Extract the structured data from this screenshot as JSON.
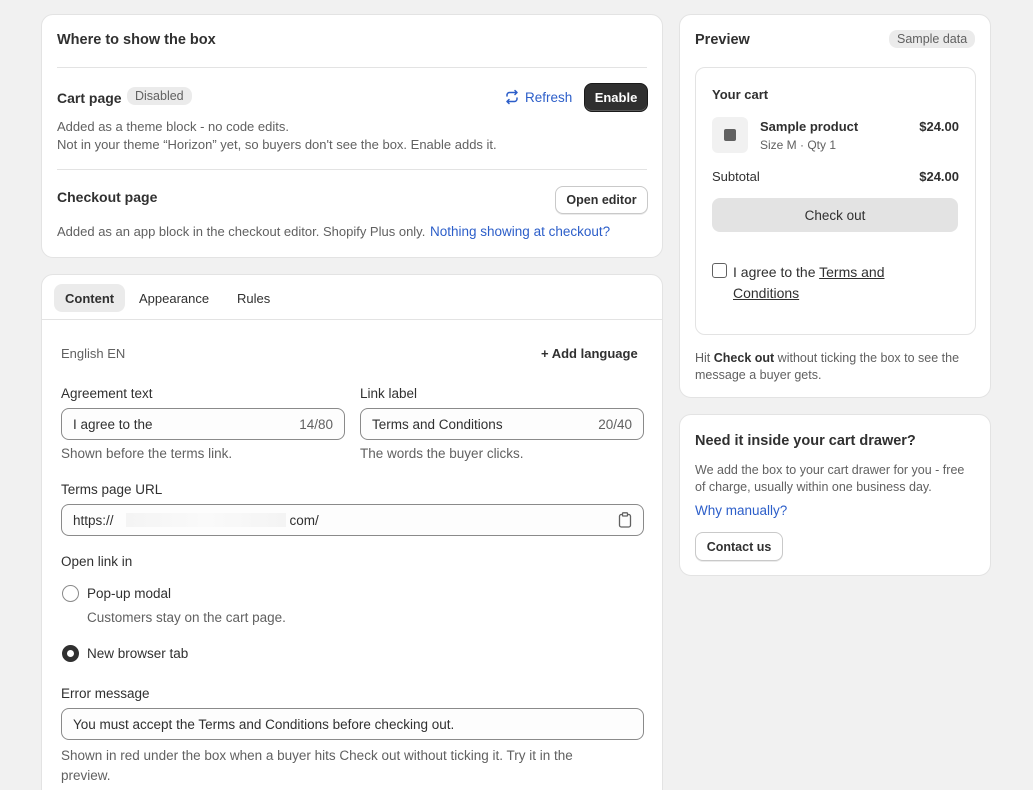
{
  "where": {
    "title": "Where to show the box",
    "cart": {
      "title": "Cart page",
      "badge": "Disabled",
      "refresh_label": "Refresh",
      "enable_label": "Enable",
      "desc1": "Added as a theme block - no code edits.",
      "desc2": "Not in your theme “Horizon” yet, so buyers don't see the box. Enable adds it."
    },
    "checkout": {
      "title": "Checkout page",
      "open_editor_label": "Open editor",
      "desc": "Added as an app block in the checkout editor. Shopify Plus only.",
      "link": "Nothing showing at checkout?"
    }
  },
  "editor": {
    "tabs": [
      {
        "label": "Content"
      },
      {
        "label": "Appearance"
      },
      {
        "label": "Rules"
      }
    ],
    "language": "English EN",
    "add_language_label": "+ Add language",
    "agreement": {
      "label": "Agreement text",
      "value": "I agree to the",
      "count": "14/80",
      "help": "Shown before the terms link."
    },
    "link_label": {
      "label": "Link label",
      "value": "Terms and Conditions",
      "count": "20/40",
      "help": "The words the buyer clicks."
    },
    "terms_url": {
      "label": "Terms page URL",
      "value_start": "https://",
      "value_end": "com/"
    },
    "open_link": {
      "label": "Open link in",
      "options": [
        {
          "label": "Pop-up modal",
          "help": "Customers stay on the cart page."
        },
        {
          "label": "New browser tab"
        }
      ],
      "selected": "New browser tab"
    },
    "error": {
      "label": "Error message",
      "value": "You must accept the Terms and Conditions before checking out.",
      "help": "Shown in red under the box when a buyer hits Check out without ticking it. Try it in the preview."
    }
  },
  "preview": {
    "title": "Preview",
    "badge": "Sample data",
    "cart_title": "Your cart",
    "product_name": "Sample product",
    "product_meta": "Size M · Qty 1",
    "product_price": "$24.00",
    "subtotal_label": "Subtotal",
    "subtotal_value": "$24.00",
    "checkout_label": "Check out",
    "agree_prefix": "I agree to the ",
    "agree_link": "Terms and Conditions",
    "hint_prefix": "Hit ",
    "hint_bold": "Check out",
    "hint_suffix": " without ticking the box to see the message a buyer gets."
  },
  "drawer": {
    "title": "Need it inside your cart drawer?",
    "desc": "We add the box to your cart drawer for you - free of charge, usually within one business day.",
    "link": "Why manually?",
    "contact_label": "Contact us"
  }
}
